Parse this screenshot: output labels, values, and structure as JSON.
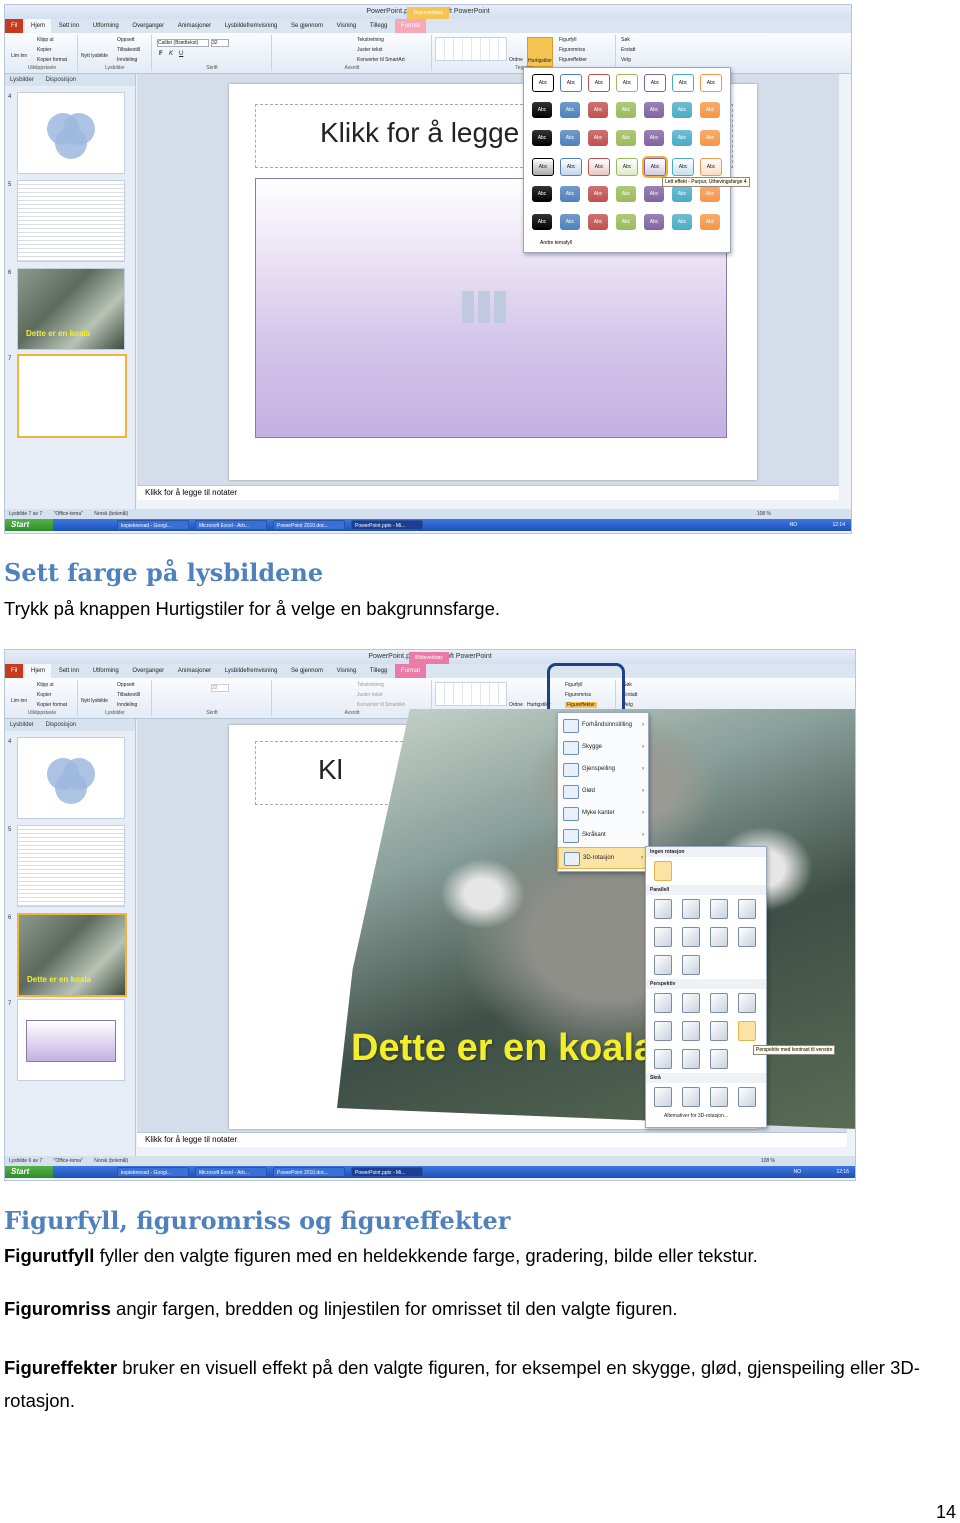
{
  "screenshot1": {
    "window_title": "PowerPoint.pptx - Microsoft PowerPoint",
    "context_tab_group": "Tegneverktøy",
    "tabs": [
      "Fil",
      "Hjem",
      "Sett inn",
      "Utforming",
      "Overganger",
      "Animasjoner",
      "Lysbildefremvisning",
      "Se gjennom",
      "Visning",
      "Tillegg",
      "Format"
    ],
    "clipboard": {
      "paste": "Lim inn",
      "cut": "Klipp ut",
      "copy": "Kopier",
      "format_painter": "Kopier format",
      "group": "Utklippstavle"
    },
    "slides_group": {
      "new_slide": "Nytt lysbilde",
      "layout": "Oppsett",
      "reset": "Tilbakestill",
      "section": "Inndeling",
      "group": "Lysbilder"
    },
    "font_group": {
      "font": "Calibri (Brødtekst)",
      "size": "32",
      "group": "Skrift"
    },
    "paragraph_group": {
      "text_direction": "Tekstretning",
      "align_text": "Juster tekst",
      "smartart": "Konverter til SmartArt",
      "group": "Avsnitt"
    },
    "drawing_group": {
      "arrange": "Ordne",
      "quick_styles": "Hurtigstiler",
      "fill": "Figurfyll",
      "outline": "Figuromriss",
      "effects": "Figureffekter",
      "group": "Tegning"
    },
    "editing_group": {
      "find": "Søk",
      "replace": "Erstatt",
      "select": "Velg"
    },
    "panel_tabs": [
      "Lysbilder",
      "Disposisjon"
    ],
    "slide_numbers": [
      "4",
      "5",
      "6",
      "7"
    ],
    "thumb_koala_caption": "Dette er en koala",
    "slide_title_placeholder": "Klikk for å legge",
    "gallery_swatch_label": "Abc",
    "gallery_tooltip": "Lett effekt - Purpur, Uthevingsfarge 4",
    "gallery_more": "Andre temafyll",
    "notes_placeholder": "Klikk for å legge til notater",
    "status_slide": "Lysbilde 7 av 7",
    "status_theme": "\"Office-tema\"",
    "status_lang": "Norsk (bokmål)",
    "zoom": "108 %",
    "taskbar_start": "Start",
    "taskbar_items": [
      "kopieknevad - Googl...",
      "Microsoft Excel - Arb...",
      "PowerPoint 2010.doc...",
      "PowerPoint.pptx - Mi..."
    ],
    "tray_lang": "NO",
    "clock": "12:14",
    "swatch_colors": [
      "#ffffff",
      "#000000",
      "#4f81bd",
      "#c0504d",
      "#9bbb59",
      "#8064a2",
      "#4bacc6",
      "#f79646"
    ]
  },
  "heading1": "Sett farge på lysbildene",
  "para1": "Trykk på knappen Hurtigstiler for å velge en bakgrunnsfarge.",
  "screenshot2": {
    "window_title": "PowerPoint.pptx - Microsoft PowerPoint",
    "context_tab_group": "Bildeverktøy",
    "menu_items": [
      "Forhåndsinnstilling",
      "Skygge",
      "Gjenspeiling",
      "Glød",
      "Myke kanter",
      "Skråkant",
      "3D-rotasjon"
    ],
    "submenu": {
      "no_rotation": "Ingen rotasjon",
      "parallel": "Parallell",
      "perspective": "Perspektiv",
      "oblique": "Skrå",
      "tooltip": "Perspektiv med kontrast til venstre",
      "more": "Alternativer for 3D-rotasjon..."
    },
    "slide_title_partial": "Kl",
    "koala_caption": "Dette er en koala",
    "thumb_koala_caption": "Dette er en koala",
    "notes_placeholder": "Klikk for å legge til notater",
    "status_slide": "Lysbilde 6 av 7",
    "clock": "12:16"
  },
  "heading2": "Figurfyll, figuromriss og figureffekter",
  "p_fill": {
    "term": "Figurutfyll",
    "text": " fyller den valgte figuren med en heldekkende farge, gradering, bilde eller tekstur."
  },
  "p_outline": {
    "term": "Figuromriss",
    "text": " angir fargen, bredden og linjestilen for omrisset til den valgte figuren."
  },
  "p_effects": {
    "term": "Figureffekter",
    "text": " bruker en visuell effekt på den valgte figuren, for eksempel en skygge, glød, gjenspeiling eller 3D-rotasjon."
  },
  "page_number": "14",
  "colors": {
    "heading": "#4f81bd",
    "accent_purple": "#8064a2",
    "highlight_ring": "#1f3f86",
    "ribbon_orange": "#f6c453"
  }
}
